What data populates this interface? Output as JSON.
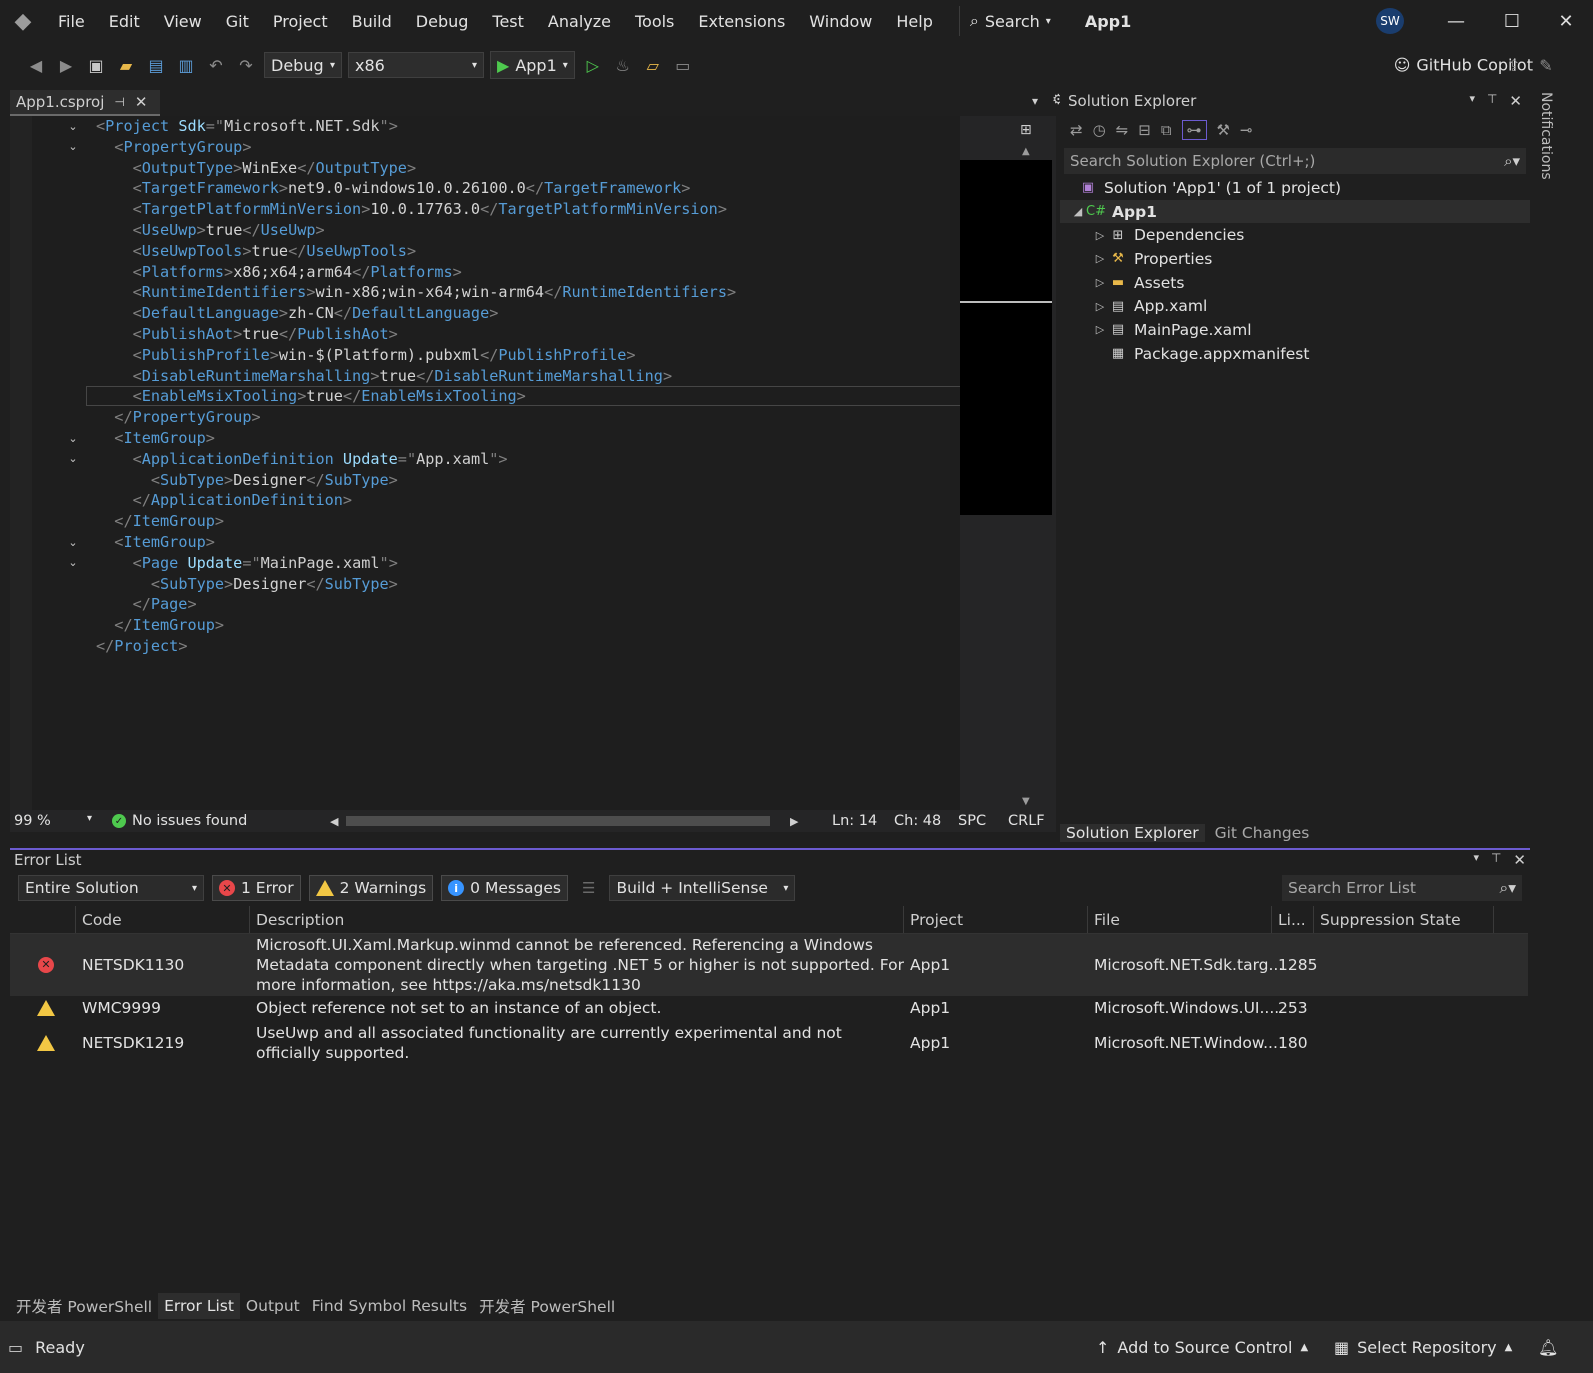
{
  "titlebar": {
    "menus": [
      "File",
      "Edit",
      "View",
      "Git",
      "Project",
      "Build",
      "Debug",
      "Test",
      "Analyze",
      "Tools",
      "Extensions",
      "Window",
      "Help"
    ],
    "search_label": "Search",
    "app_name": "App1",
    "avatar_initials": "SW"
  },
  "toolbar": {
    "config": "Debug",
    "platform": "x86",
    "run_target": "App1",
    "copilot_label": "GitHub Copilot"
  },
  "editor": {
    "tab_label": "App1.csproj",
    "zoom": "99 %",
    "issues": "No issues found",
    "ln": "Ln: 14",
    "ch": "Ch: 48",
    "spc": "SPC",
    "crlf": "CRLF",
    "lines": [
      {
        "i": 0,
        "open": "Project",
        "attrs": [
          [
            "Sdk",
            "Microsoft.NET.Sdk"
          ]
        ]
      },
      {
        "i": 1,
        "open": "PropertyGroup"
      },
      {
        "i": 2,
        "elem": "OutputType",
        "val": "WinExe"
      },
      {
        "i": 2,
        "elem": "TargetFramework",
        "val": "net9.0-windows10.0.26100.0"
      },
      {
        "i": 2,
        "elem": "TargetPlatformMinVersion",
        "val": "10.0.17763.0"
      },
      {
        "i": 2,
        "elem": "UseUwp",
        "val": "true"
      },
      {
        "i": 2,
        "elem": "UseUwpTools",
        "val": "true"
      },
      {
        "i": 2,
        "elem": "Platforms",
        "val": "x86;x64;arm64"
      },
      {
        "i": 2,
        "elem": "RuntimeIdentifiers",
        "val": "win-x86;win-x64;win-arm64"
      },
      {
        "i": 2,
        "elem": "DefaultLanguage",
        "val": "zh-CN"
      },
      {
        "i": 2,
        "elem": "PublishAot",
        "val": "true"
      },
      {
        "i": 2,
        "elem": "PublishProfile",
        "val": "win-$(Platform).pubxml"
      },
      {
        "i": 2,
        "elem": "DisableRuntimeMarshalling",
        "val": "true"
      },
      {
        "i": 2,
        "elem": "EnableMsixTooling",
        "val": "true"
      },
      {
        "i": 1,
        "close": "PropertyGroup"
      },
      {
        "i": 1,
        "open": "ItemGroup"
      },
      {
        "i": 2,
        "open": "ApplicationDefinition",
        "attrs": [
          [
            "Update",
            "App.xaml"
          ]
        ]
      },
      {
        "i": 3,
        "elem": "SubType",
        "val": "Designer"
      },
      {
        "i": 2,
        "close": "ApplicationDefinition"
      },
      {
        "i": 1,
        "close": "ItemGroup"
      },
      {
        "i": 1,
        "open": "ItemGroup"
      },
      {
        "i": 2,
        "open": "Page",
        "attrs": [
          [
            "Update",
            "MainPage.xaml"
          ]
        ]
      },
      {
        "i": 3,
        "elem": "SubType",
        "val": "Designer"
      },
      {
        "i": 2,
        "close": "Page"
      },
      {
        "i": 1,
        "close": "ItemGroup"
      },
      {
        "i": 0,
        "close": "Project"
      }
    ]
  },
  "solution_explorer": {
    "title": "Solution Explorer",
    "search_placeholder": "Search Solution Explorer (Ctrl+;)",
    "solution": "Solution 'App1' (1 of 1 project)",
    "project": "App1",
    "items": [
      "Dependencies",
      "Properties",
      "Assets",
      "App.xaml",
      "MainPage.xaml",
      "Package.appxmanifest"
    ],
    "tabs": [
      "Solution Explorer",
      "Git Changes"
    ]
  },
  "notifications_label": "Notifications",
  "error_list": {
    "title": "Error List",
    "scope": "Entire Solution",
    "errors": "1 Error",
    "warnings": "2 Warnings",
    "messages": "0 Messages",
    "source": "Build + IntelliSense",
    "search_placeholder": "Search Error List",
    "columns": [
      "Code",
      "Description",
      "Project",
      "File",
      "Li...",
      "Suppression State"
    ],
    "rows": [
      {
        "severity": "error",
        "code": "NETSDK1130",
        "description": "Microsoft.UI.Xaml.Markup.winmd cannot be referenced. Referencing a Windows Metadata component directly when targeting .NET 5 or higher is not supported. For more information, see https://aka.ms/netsdk1130",
        "project": "App1",
        "file": "Microsoft.NET.Sdk.targ...",
        "line": "1285"
      },
      {
        "severity": "warning",
        "code": "WMC9999",
        "description": "Object reference not set to an instance of an object.",
        "project": "App1",
        "file": "Microsoft.Windows.UI....",
        "line": "253"
      },
      {
        "severity": "warning",
        "code": "NETSDK1219",
        "description": "UseUwp and all associated functionality are currently experimental and not officially supported.",
        "project": "App1",
        "file": "Microsoft.NET.Window...",
        "line": "180"
      }
    ]
  },
  "bottom_tabs": [
    "开发者 PowerShell",
    "Error List",
    "Output",
    "Find Symbol Results",
    "开发者 PowerShell"
  ],
  "statusbar": {
    "ready": "Ready",
    "add_source": "Add to Source Control",
    "select_repo": "Select Repository"
  },
  "colors": {
    "accent": "#6c5bd0",
    "tag": "#569cd6",
    "attr": "#9cdcfe",
    "error": "#e8474a",
    "warning": "#f2c744",
    "info": "#3794ff",
    "run": "#4ec94e"
  }
}
